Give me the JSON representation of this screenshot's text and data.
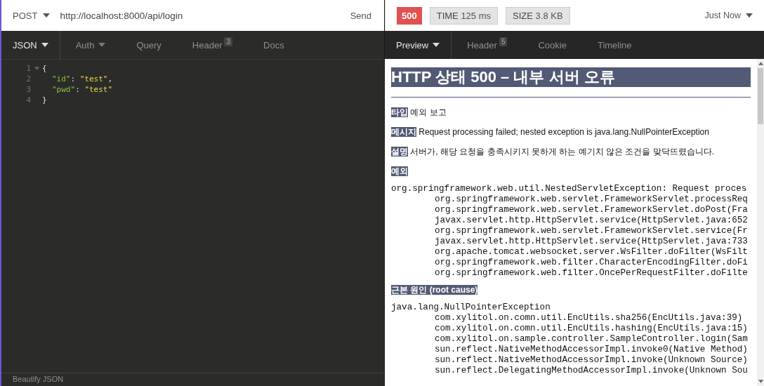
{
  "request": {
    "method": "POST",
    "url": "http://localhost:8000/api/login",
    "send_label": "Send"
  },
  "request_tabs": [
    {
      "label": "JSON",
      "dropdown": true,
      "selected": true
    },
    {
      "label": "Auth",
      "dropdown": true,
      "selected": false
    },
    {
      "label": "Query",
      "dropdown": false,
      "selected": false
    },
    {
      "label": "Header",
      "badge": "3",
      "dropdown": false,
      "selected": false
    },
    {
      "label": "Docs",
      "dropdown": false,
      "selected": false
    }
  ],
  "editor_lines": [
    {
      "number": "1",
      "foldable": true,
      "tokens": [
        {
          "kind": "punct",
          "text": "{"
        }
      ],
      "children": [
        {
          "number": "2",
          "foldable": false,
          "tokens": [
            {
              "kind": "key",
              "text": "\"id\""
            },
            {
              "kind": "punct",
              "text": ": "
            },
            {
              "kind": "string",
              "text": "\"test\""
            },
            {
              "kind": "punct",
              "text": ","
            }
          ]
        },
        {
          "number": "3",
          "foldable": false,
          "tokens": [
            {
              "kind": "key",
              "text": "\"pwd\""
            },
            {
              "kind": "punct",
              "text": ": "
            },
            {
              "kind": "string",
              "text": "\"test\""
            }
          ]
        }
      ]
    },
    {
      "number": "4",
      "foldable": false,
      "tokens": [
        {
          "kind": "punct",
          "text": "}"
        }
      ]
    }
  ],
  "editor_footer": "Beautify JSON",
  "response": {
    "status": "500",
    "time_label": "TIME",
    "time": "125 ms",
    "size_label": "SIZE",
    "size": "3.8 KB",
    "history": "Just Now"
  },
  "response_tabs": [
    {
      "label": "Preview",
      "dropdown": true,
      "selected": true
    },
    {
      "label": "Header",
      "badge": "5",
      "dropdown": false,
      "selected": false
    },
    {
      "label": "Cookie",
      "dropdown": false,
      "selected": false
    },
    {
      "label": "Timeline",
      "dropdown": false,
      "selected": false
    }
  ],
  "preview": {
    "title": "HTTP 상태 500 – 내부 서버 오류",
    "fields": [
      {
        "label": "타입",
        "text": "예외 보고"
      },
      {
        "label": "메시지",
        "text": "Request processing failed; nested exception is java.lang.NullPointerException"
      },
      {
        "label": "설명",
        "text": "서버가, 해당 요청을 충족시키지 못하게 하는 예기치 않은 조건을 맞닥뜨렸습니다."
      }
    ],
    "sections": [
      {
        "heading": "예외",
        "trace": {
          "text": "org.springframework.web.util.NestedServletException: Request proces",
          "frames": [
            "org.springframework.web.servlet.FrameworkServlet.processReq",
            "org.springframework.web.servlet.FrameworkServlet.doPost(Fra",
            "javax.servlet.http.HttpServlet.service(HttpServlet.java:652",
            "org.springframework.web.servlet.FrameworkServlet.service(Fr",
            "javax.servlet.http.HttpServlet.service(HttpServlet.java:733",
            "org.apache.tomcat.websocket.server.WsFilter.doFilter(WsFilt",
            "org.springframework.web.filter.CharacterEncodingFilter.doFi",
            "org.springframework.web.filter.OncePerRequestFilter.doFilte"
          ]
        }
      },
      {
        "heading": "근본 원인 (root cause)",
        "trace": {
          "text": "java.lang.NullPointerException",
          "frames": [
            "com.xylitol.on.comn.util.EncUtils.sha256(EncUtils.java:39)",
            "com.xylitol.on.comn.util.EncUtils.hashing(EncUtils.java:15)",
            "com.xylitol.on.sample.controller.SampleController.login(Sam",
            "sun.reflect.NativeMethodAccessorImpl.invoke0(Native Method)",
            "sun.reflect.NativeMethodAccessorImpl.invoke(Unknown Source)",
            "sun.reflect.DelegatingMethodAccessorImpl.invoke(Unknown Sou"
          ]
        }
      }
    ]
  }
}
